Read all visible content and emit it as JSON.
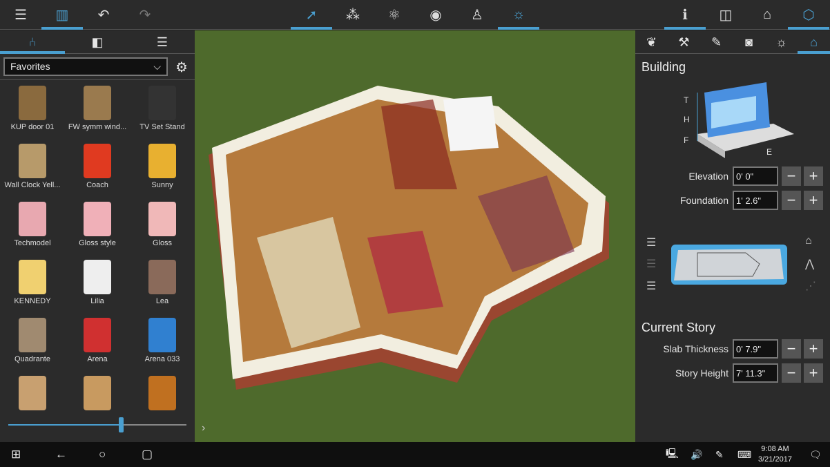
{
  "toolbar": {
    "left": [
      {
        "icon": "menu-icon"
      },
      {
        "icon": "library-icon",
        "active": true
      },
      {
        "icon": "undo-icon"
      },
      {
        "icon": "redo-icon"
      }
    ],
    "center": [
      {
        "icon": "select-arrow-icon",
        "active": true
      },
      {
        "icon": "footprints-icon"
      },
      {
        "icon": "orbit-icon"
      },
      {
        "icon": "eye-icon"
      },
      {
        "icon": "walk-stairs-icon"
      },
      {
        "icon": "sun-icon",
        "active": true
      }
    ],
    "right": [
      {
        "icon": "info-icon",
        "active": true
      },
      {
        "icon": "plan-2d-icon"
      },
      {
        "icon": "home-icon"
      },
      {
        "icon": "cube-3d-icon",
        "active": true
      }
    ]
  },
  "left_panel": {
    "tabs": [
      {
        "icon": "furniture-icon",
        "active": true
      },
      {
        "icon": "materials-icon"
      },
      {
        "icon": "list-icon"
      }
    ],
    "category": "Favorites",
    "items": [
      {
        "label": "KUP door 01",
        "color": "#8a6a3e"
      },
      {
        "label": "FW symm wind...",
        "color": "#9a7a4e"
      },
      {
        "label": "TV Set Stand",
        "color": "#333"
      },
      {
        "label": "Wall Clock Yell...",
        "color": "#b79a6a"
      },
      {
        "label": "Coach",
        "color": "#e03a20"
      },
      {
        "label": "Sunny",
        "color": "#e8b030"
      },
      {
        "label": "Techmodel",
        "color": "#e8a8b0"
      },
      {
        "label": "Gloss style",
        "color": "#f0b0b8"
      },
      {
        "label": "Gloss",
        "color": "#f0b8b8"
      },
      {
        "label": "KENNEDY",
        "color": "#f0d070"
      },
      {
        "label": "Lilia",
        "color": "#eee"
      },
      {
        "label": "Lea",
        "color": "#8a6a5a"
      },
      {
        "label": "Quadrante",
        "color": "#a08a70"
      },
      {
        "label": "Arena",
        "color": "#d03030"
      },
      {
        "label": "Arena 033",
        "color": "#3080d0"
      },
      {
        "label": "",
        "color": "#c8a070"
      },
      {
        "label": "",
        "color": "#c89a60"
      },
      {
        "label": "",
        "color": "#c07020"
      }
    ],
    "zoom_slider": 0.63
  },
  "right_panel": {
    "tabs": [
      {
        "icon": "garden-icon"
      },
      {
        "icon": "paint-brush-icon"
      },
      {
        "icon": "pencil-icon"
      },
      {
        "icon": "camera-icon"
      },
      {
        "icon": "light-icon"
      },
      {
        "icon": "building-icon",
        "active": true
      }
    ],
    "building_title": "Building",
    "diagram_labels": [
      "T",
      "H",
      "F",
      "E"
    ],
    "elevation": {
      "label": "Elevation",
      "value": "0' 0\""
    },
    "foundation": {
      "label": "Foundation",
      "value": "1' 2.6\""
    },
    "story_title": "Current Story",
    "slab": {
      "label": "Slab Thickness",
      "value": "0' 7.9\""
    },
    "story_height": {
      "label": "Story Height",
      "value": "7' 11.3\""
    },
    "minus": "−",
    "plus": "+"
  },
  "taskbar": {
    "time": "9:08 AM",
    "date": "3/21/2017"
  }
}
